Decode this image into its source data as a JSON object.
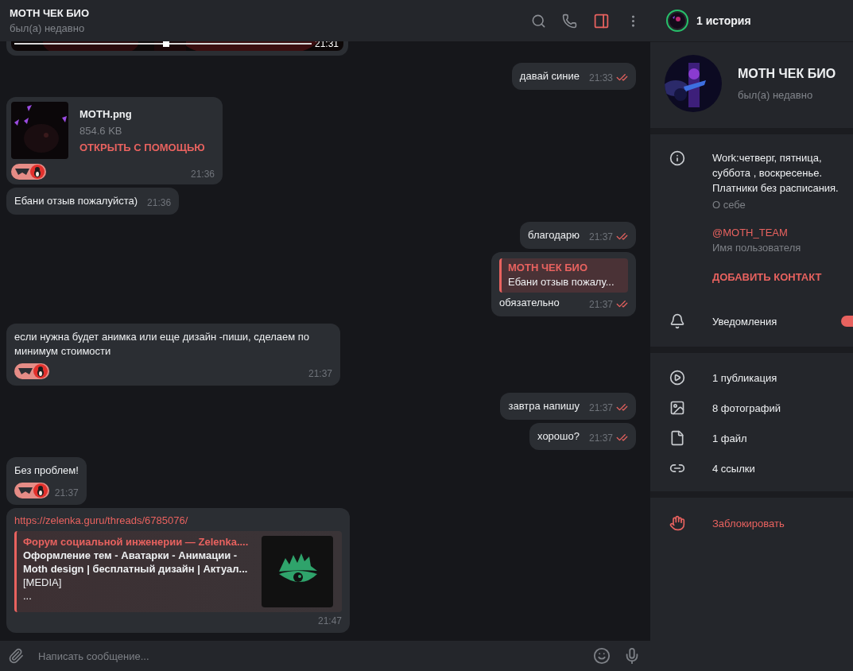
{
  "chat_header": {
    "title": "MOTH ЧЕК БИО",
    "status": "был(а) недавно",
    "panel_open": true
  },
  "messages": [
    {
      "kind": "video",
      "outgoing": false,
      "time": "21:31",
      "level": 0.5
    },
    {
      "kind": "text",
      "outgoing": true,
      "text": "давай синие",
      "time": "21:33",
      "read": true
    },
    {
      "kind": "file",
      "outgoing": false,
      "name": "MOTH.png",
      "size": "854.6 KB",
      "action": "ОТКРЫТЬ С ПОМОЩЬЮ",
      "reaction": true,
      "time": "21:36"
    },
    {
      "kind": "text",
      "outgoing": false,
      "text": "Ебани отзыв пожалуйста)",
      "reaction": false,
      "time": "21:36"
    },
    {
      "kind": "text",
      "outgoing": true,
      "text": "благодарю",
      "time": "21:37",
      "read": true
    },
    {
      "kind": "reply",
      "outgoing": true,
      "quote_author": "MOTH ЧЕК БИО",
      "quote_text": "Ебани отзыв пожалу...",
      "text": "обязательно",
      "time": "21:37",
      "read": true
    },
    {
      "kind": "text",
      "outgoing": false,
      "text": "если нужна будет анимка или еще дизайн -пиши, сделаем по минимум стоимости",
      "reaction": true,
      "time": "21:37"
    },
    {
      "kind": "text",
      "outgoing": true,
      "text": "завтра напишу",
      "time": "21:37",
      "read": true
    },
    {
      "kind": "text",
      "outgoing": true,
      "text": "хорошо?",
      "time": "21:37",
      "read": true
    },
    {
      "kind": "text",
      "outgoing": false,
      "text": "Без проблем!",
      "reaction": true,
      "time": "21:37"
    },
    {
      "kind": "link",
      "outgoing": false,
      "url": "https://zelenka.guru/threads/6785076/",
      "site": "Форум социальной инженерии —  Zelenka....",
      "lines": [
        {
          "text": "Оформление тем - Аватарки - Анимации -",
          "bold": true
        },
        {
          "text": "Moth design | бесплатный дизайн | Актуал...",
          "bold": true
        },
        {
          "text": "[MEDIA]",
          "bold": false
        },
        {
          "text": "...",
          "bold": false
        }
      ],
      "time": "21:47"
    }
  ],
  "composer": {
    "placeholder": "Написать сообщение..."
  },
  "info_panel": {
    "stories": "1 история",
    "name": "MOTH ЧЕК БИО",
    "status": "был(а) недавно",
    "bio": "Work:четверг, пятница, суббота , воскресенье. Платники без расписания.",
    "bio_label": "О себе",
    "username": "@MOTH_TEAM",
    "username_label": "Имя пользователя",
    "add_contact": "ДОБАВИТЬ КОНТАКТ",
    "notifications": {
      "label": "Уведомления",
      "on": true
    },
    "media": [
      {
        "kind": "publications",
        "label": "1 публикация"
      },
      {
        "kind": "photos",
        "label": "8 фотографий"
      },
      {
        "kind": "files",
        "label": "1 файл"
      },
      {
        "kind": "links",
        "label": "4 ссылки"
      }
    ],
    "block": "Заблокировать"
  }
}
